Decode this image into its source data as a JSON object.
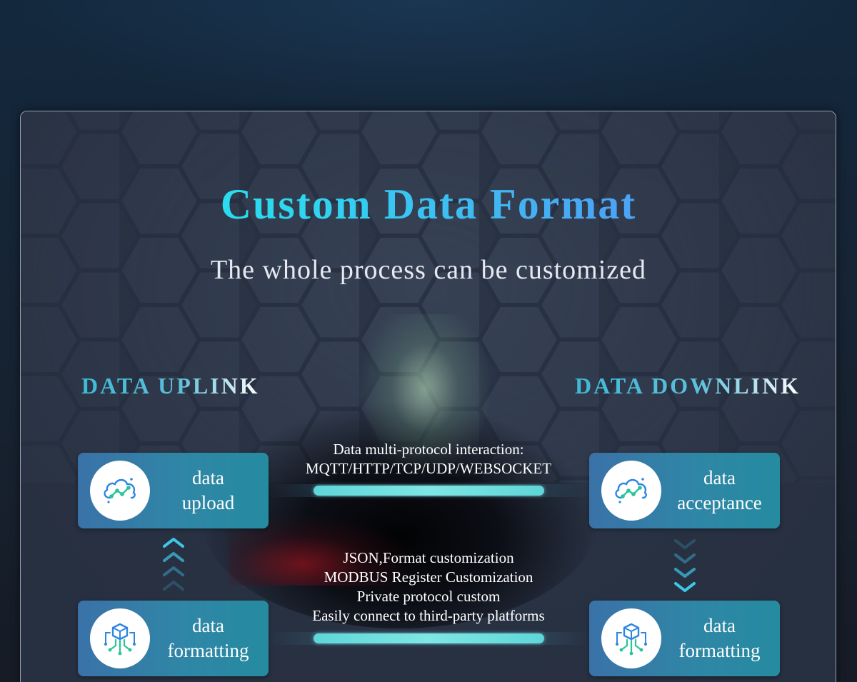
{
  "title": "Custom Data Format",
  "subtitle": "The whole process can be customized",
  "uplink": {
    "heading": "DATA UPLINK",
    "top_card": {
      "label_line1": "data",
      "label_line2": "upload",
      "icon": "cloud-data-icon"
    },
    "bottom_card": {
      "label_line1": "data",
      "label_line2": "formatting",
      "icon": "chip-circuit-icon"
    },
    "arrow_icon": "double-chevron-up-icon"
  },
  "downlink": {
    "heading": "DATA DOWNLINK",
    "top_card": {
      "label_line1": "data",
      "label_line2": "acceptance",
      "icon": "cloud-data-icon"
    },
    "bottom_card": {
      "label_line1": "data",
      "label_line2": "formatting",
      "icon": "chip-circuit-icon"
    },
    "arrow_icon": "double-chevron-down-icon"
  },
  "protocols": {
    "top_line1": "Data multi-protocol interaction:",
    "top_line2": "MQTT/HTTP/TCP/UDP/WEBSOCKET",
    "bottom_lines": [
      "JSON,Format customization",
      "MODBUS Register Customization",
      "Private protocol custom",
      "Easily connect to third-party platforms"
    ]
  },
  "colors": {
    "title_gradient_start": "#19f0e8",
    "title_gradient_end": "#5a8ff5",
    "card_start": "#3a72a8",
    "card_end": "#258ba0",
    "connector": "#7fe6e3",
    "panel": "#2f3a4d"
  }
}
